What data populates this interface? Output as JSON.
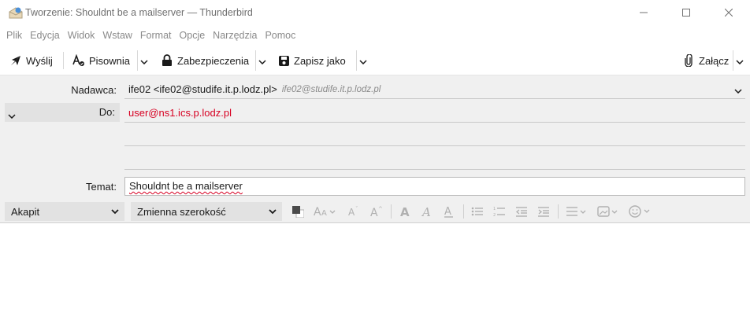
{
  "window": {
    "title": "Tworzenie: Shouldnt be a mailserver — Thunderbird"
  },
  "menu": [
    "Plik",
    "Edycja",
    "Widok",
    "Wstaw",
    "Format",
    "Opcje",
    "Narzędzia",
    "Pomoc"
  ],
  "toolbar": {
    "send_label": "Wyślij",
    "spelling_label": "Pisownia",
    "security_label": "Zabezpieczenia",
    "save_label": "Zapisz jako",
    "attach_label": "Załącz"
  },
  "header": {
    "from_label": "Nadawca:",
    "from_value": "ife02 <ife02@studife.it.p.lodz.pl>",
    "from_identity": "ife02@studife.it.p.lodz.pl",
    "to_label": "Do:",
    "to_value": "user@ns1.ics.p.lodz.pl",
    "subject_label": "Temat:",
    "subject_value": "Shouldnt be a mailserver"
  },
  "format": {
    "paragraph": "Akapit",
    "font": "Zmienna szerokość"
  },
  "colors": {
    "recipient": "#d70022",
    "header_bg": "#f0f0f0"
  }
}
